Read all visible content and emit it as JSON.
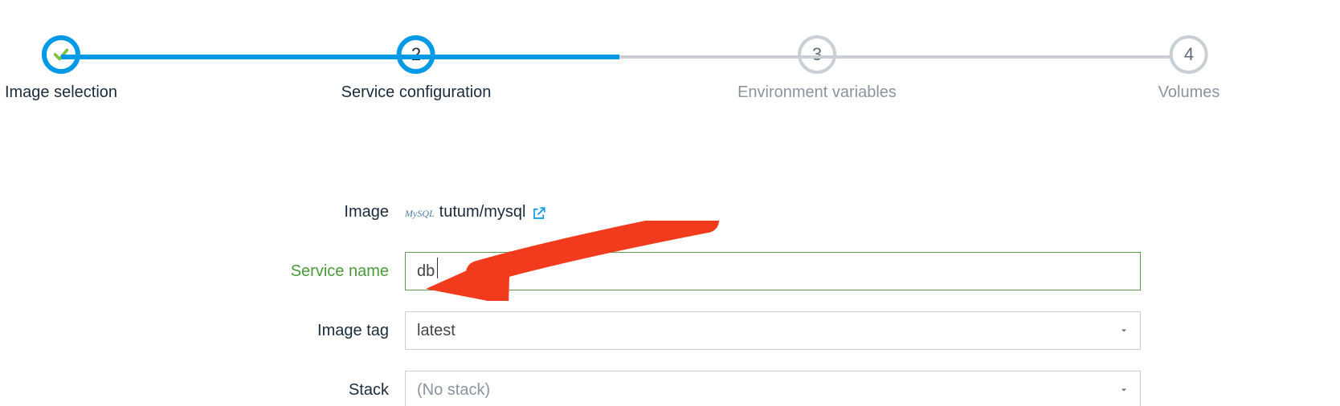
{
  "stepper": {
    "steps": [
      {
        "label": "Image selection",
        "state": "completed"
      },
      {
        "label": "Service configuration",
        "state": "active",
        "num": "2"
      },
      {
        "label": "Environment variables",
        "state": "pending",
        "num": "3"
      },
      {
        "label": "Volumes",
        "state": "pending",
        "num": "4"
      }
    ]
  },
  "form": {
    "image_label": "Image",
    "image_value": "tutum/mysql",
    "image_icon_text": "MySQL",
    "service_name_label": "Service name",
    "service_name_value": "db",
    "image_tag_label": "Image tag",
    "image_tag_value": "latest",
    "stack_label": "Stack",
    "stack_value": "(No stack)"
  }
}
